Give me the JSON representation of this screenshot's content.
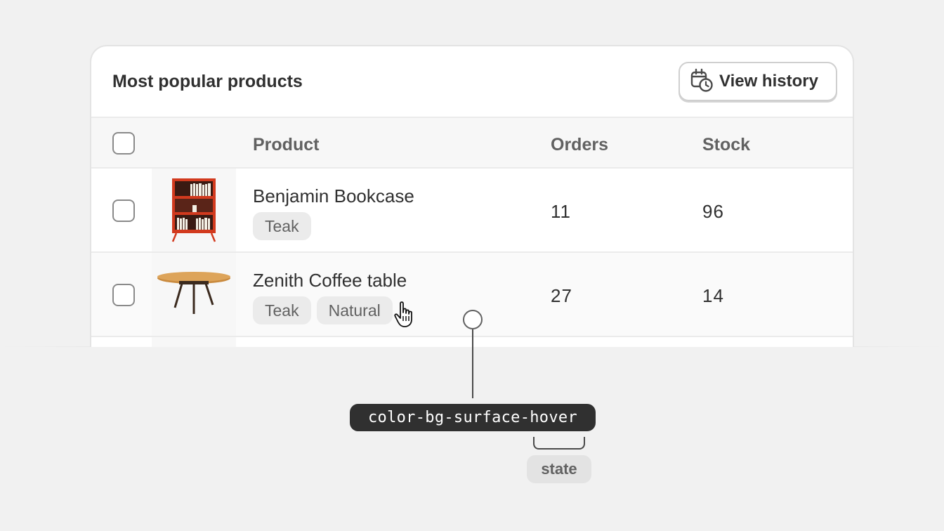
{
  "card": {
    "title": "Most popular products",
    "view_history_label": "View history",
    "view_history_icon": "calendar-clock-icon"
  },
  "table": {
    "columns": [
      "Product",
      "Orders",
      "Stock"
    ],
    "rows": [
      {
        "name": "Benjamin Bookcase",
        "tags": [
          "Teak"
        ],
        "orders": "11",
        "stock": "96",
        "image": "bookcase-image"
      },
      {
        "name": "Zenith Coffee table",
        "tags": [
          "Teak",
          "Natural"
        ],
        "orders": "27",
        "stock": "14",
        "image": "coffee-table-image",
        "state": "hover"
      }
    ]
  },
  "annotation": {
    "token": "color-bg-surface-hover",
    "state_label": "state"
  },
  "colors": {
    "background": "#f1f1f1",
    "surface": "#ffffff",
    "surface_hover": "#fafafa",
    "header_bg": "#f7f7f7",
    "text": "#303030",
    "text_secondary": "#616161",
    "tag_bg": "#ebebeb",
    "token_bg": "#303030",
    "bookcase_red": "#d23a1e"
  }
}
